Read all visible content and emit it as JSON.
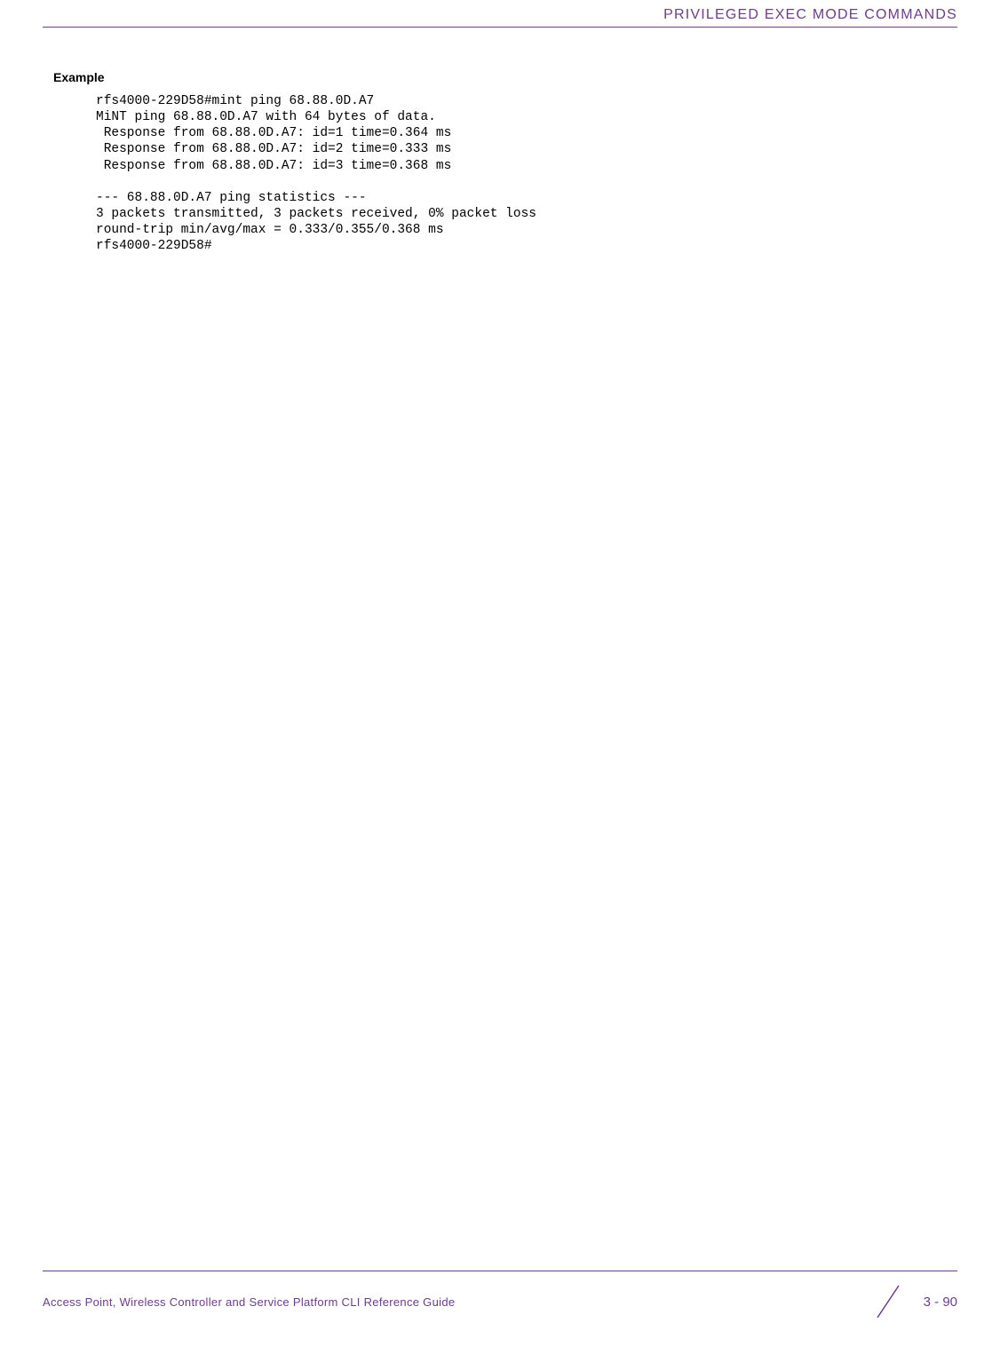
{
  "header": {
    "title": "PRIVILEGED EXEC MODE COMMANDS"
  },
  "section": {
    "heading": "Example"
  },
  "code": {
    "text": "rfs4000-229D58#mint ping 68.88.0D.A7\nMiNT ping 68.88.0D.A7 with 64 bytes of data.\n Response from 68.88.0D.A7: id=1 time=0.364 ms\n Response from 68.88.0D.A7: id=2 time=0.333 ms\n Response from 68.88.0D.A7: id=3 time=0.368 ms\n\n--- 68.88.0D.A7 ping statistics ---\n3 packets transmitted, 3 packets received, 0% packet loss\nround-trip min/avg/max = 0.333/0.355/0.368 ms\nrfs4000-229D58#"
  },
  "footer": {
    "guide": "Access Point, Wireless Controller and Service Platform CLI Reference Guide",
    "page": "3 - 90"
  }
}
